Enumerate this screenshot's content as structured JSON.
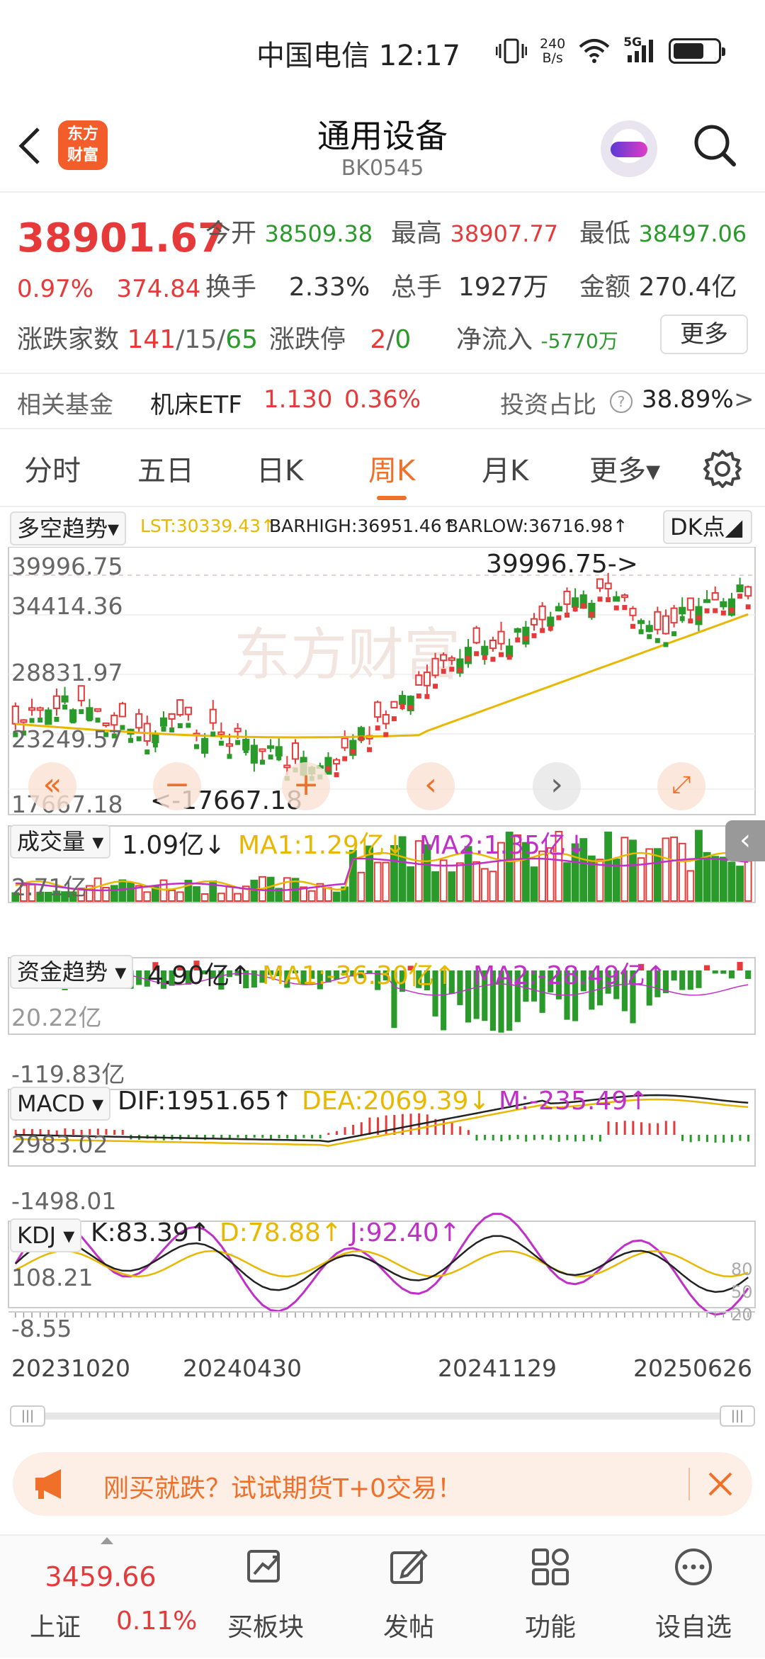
{
  "status_bar": {
    "carrier_time": "中国电信 12:17",
    "net_speed_top": "240",
    "net_speed_bottom": "B/s",
    "signal": "5G"
  },
  "header": {
    "title": "通用设备",
    "code": "BK0545",
    "logo_text_1": "东方",
    "logo_text_2": "财富"
  },
  "quote": {
    "price": "38901.67",
    "change_pct": "0.97%",
    "change": "374.84",
    "open_label": "今开",
    "open": "38509.38",
    "high_label": "最高",
    "high": "38907.77",
    "low_label": "最低",
    "low": "38497.06",
    "turnover_label": "换手",
    "turnover": "2.33%",
    "volume_label": "总手",
    "volume": "1927万",
    "amount_label": "金额",
    "amount": "270.4亿",
    "breadth_label": "涨跌家数",
    "up_count": "141",
    "flat_count": "15",
    "down_count": "65",
    "sep": "/",
    "limit_label": "涨跌停",
    "limit_up": "2",
    "limit_down": "0",
    "inflow_label": "净流入",
    "inflow": "-5770万",
    "more": "更多"
  },
  "fund": {
    "label": "相关基金",
    "name": "机床ETF",
    "price": "1.130",
    "pct": "0.36%",
    "ratio_label": "投资占比",
    "ratio": "38.89%",
    "arrow": ">"
  },
  "tabs": [
    {
      "label": "分时",
      "active": false
    },
    {
      "label": "五日",
      "active": false
    },
    {
      "label": "日K",
      "active": false
    },
    {
      "label": "周K",
      "active": true
    },
    {
      "label": "月K",
      "active": false
    },
    {
      "label": "更多▾",
      "active": false
    }
  ],
  "indicators": {
    "main_selector": "多空趋势",
    "lst": "LST:30339.43↑",
    "barhigh": "BARHIGH:36951.46↑",
    "barlow": "BARLOW:36716.98↑",
    "dk_button": "DK点",
    "vol_selector": "成交量",
    "vol_value": "1.09亿↓",
    "vol_ma1": "MA1:1.29亿↓",
    "vol_ma2": "MA2:1.35亿↓",
    "fund_selector": "资金趋势",
    "fund_value": "4.90亿↑",
    "fund_ma1": "MA1:-36.30亿↑",
    "fund_ma2": "MA2:-28.49亿↑",
    "macd_selector": "MACD",
    "dif": "DIF:1951.65↑",
    "dea": "DEA:2069.39↓",
    "m": "M:-235.49↑",
    "kdj_selector": "KDJ",
    "k": "K:83.39↑",
    "d": "D:78.88↑",
    "j": "J:92.40↑"
  },
  "axes": {
    "price_ticks": [
      "39996.75",
      "34414.36",
      "28831.97",
      "23249.57",
      "17667.18"
    ],
    "max_marker": "39996.75->",
    "min_marker": "<-17667.18",
    "vol_tick": "2.71亿",
    "fund_top": "20.22亿",
    "fund_bottom": "-119.83亿",
    "macd_top": "2983.02",
    "macd_bottom": "-1498.01",
    "kdj_top": "108.21",
    "kdj_bottom": "-8.55",
    "kdj_right": [
      "80",
      "50",
      "20"
    ],
    "dates": [
      "20231020",
      "20240430",
      "20241129",
      "20250626"
    ]
  },
  "chart_data": {
    "type": "line",
    "title": "",
    "x": [
      "20231020",
      "20240430",
      "20241129",
      "20250626"
    ],
    "ylim": [
      17667.18,
      39996.75
    ],
    "series": [
      {
        "values": [
          23249.57,
          21500,
          26500,
          38901.67
        ]
      }
    ]
  },
  "banner": {
    "text": "刚买就跌？试试期货T+0交易！"
  },
  "nav": {
    "index_value": "3459.66",
    "index_name": "上证",
    "index_pct": "0.11%",
    "items": [
      "买板块",
      "发帖",
      "功能",
      "设自选"
    ]
  },
  "colors": {
    "up": "#e63a3a",
    "down": "#2a9a2a",
    "accent": "#f0702a",
    "ma_yellow": "#e8b800",
    "ma_purple": "#c030c8"
  }
}
